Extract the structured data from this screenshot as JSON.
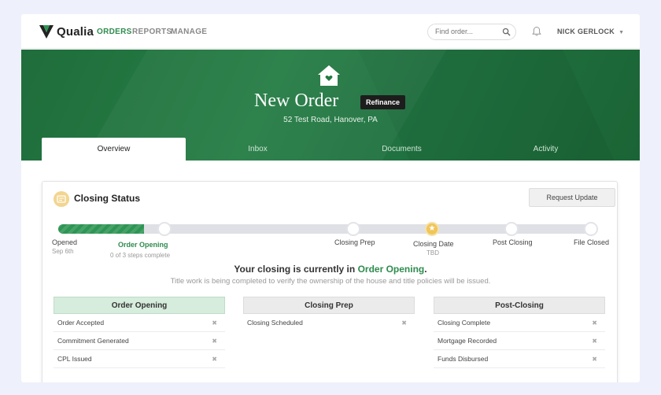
{
  "nav": {
    "brand": "Qualia",
    "links": [
      "ORDERS",
      "REPORTS",
      "MANAGE"
    ],
    "search_placeholder": "Find order...",
    "user": "NICK GERLOCK",
    "accent": "#2e8b4e"
  },
  "hero": {
    "title": "New Order",
    "badge": "Refinance",
    "address": "52 Test Road, Hanover, PA",
    "tabs": [
      "Overview",
      "Inbox",
      "Documents",
      "Activity"
    ],
    "active_tab": "Overview",
    "bg_color": "#237a42"
  },
  "closing_status": {
    "title": "Closing Status",
    "request_button": "Request Update",
    "progress": {
      "fill_percent": 16,
      "steps": {
        "opened": "Opened",
        "opened_date": "Sep 6th",
        "order_opening": "Order Opening",
        "order_opening_sub": "0 of 3 steps complete",
        "closing_prep": "Closing Prep",
        "closing_date": "Closing Date",
        "closing_date_sub": "TBD",
        "post_closing": "Post Closing",
        "file_closed": "File Closed"
      }
    },
    "message_prefix": "Your closing is currently in",
    "message_stage": "Order Opening",
    "message_suffix": ".",
    "message_sub": "Title work is being completed to verify the ownership of the house and title policies will be issued.",
    "columns": [
      {
        "title": "Order Opening",
        "active": true,
        "items": [
          "Order Accepted",
          "Commitment Generated",
          "CPL Issued"
        ]
      },
      {
        "title": "Closing Prep",
        "active": false,
        "items": [
          "Closing Scheduled"
        ]
      },
      {
        "title": "Post-Closing",
        "active": false,
        "items": [
          "Closing Complete",
          "Mortgage Recorded",
          "Funds Disbursed"
        ]
      }
    ]
  }
}
